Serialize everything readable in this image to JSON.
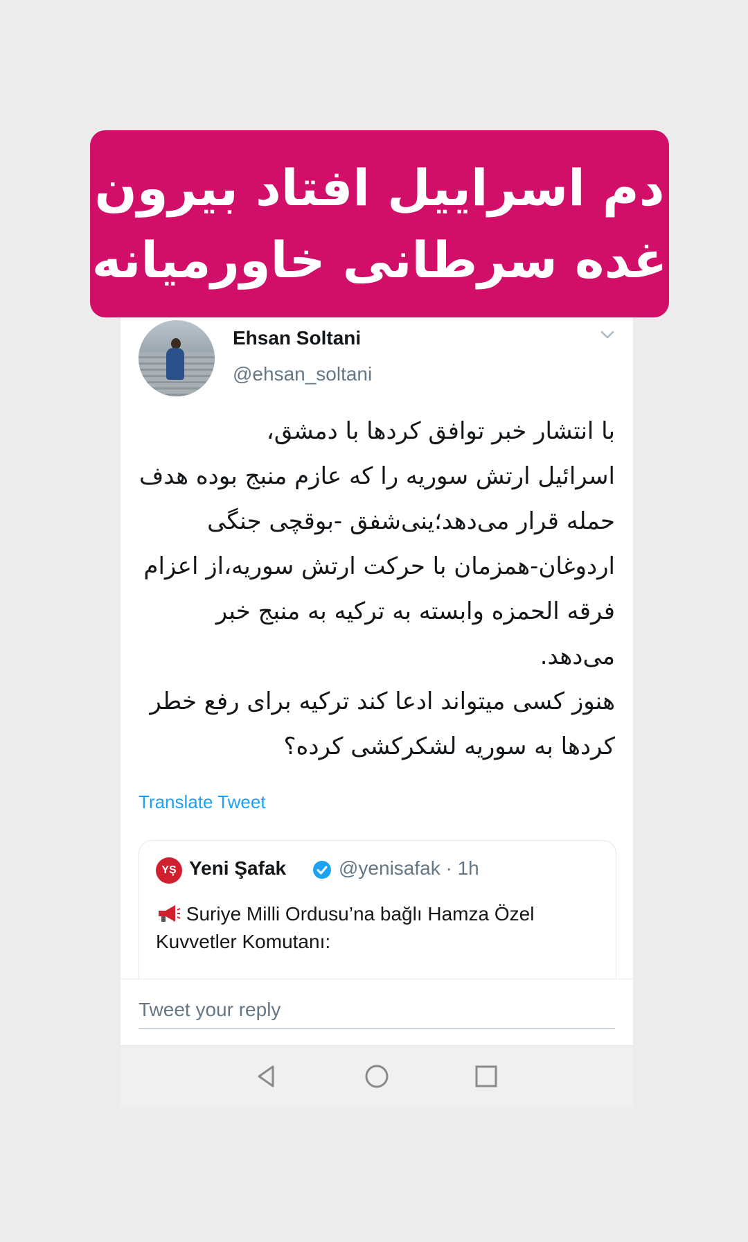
{
  "banner": {
    "line1": "دم اسراییل افتاد بیرون",
    "line2": "غده سرطانی خاورمیانه",
    "color": "#d10f68"
  },
  "tweet": {
    "author_name": "Ehsan Soltani",
    "author_handle": "@ehsan_soltani",
    "avatar_icon": "profile-photo",
    "menu_icon": "chevron-down-icon",
    "text": "با انتشار خبر توافق کردها با دمشق،\nاسرائیل ارتش سوریه را که عازم منبج بوده هدف حمله قرار می‌دهد؛ینی‌شفق -بوقچی جنگی اردوغان-همزمان با حرکت ارتش سوریه،از اعزام فرقه الحمزه وابسته به ترکیه به منبج خبر می‌دهد.\nهنوز کسی میتواند ادعا کند ترکیه برای رفع خطر کردها به سوریه لشکرکشی کرده؟",
    "translate_label": "Translate Tweet",
    "accent_color": "#1da1f2"
  },
  "quoted_tweet": {
    "logo_text": "YŞ",
    "name": "Yeni Şafak",
    "verified_icon": "verified-badge-icon",
    "handle_time": "@yenisafak · 1h",
    "emoji_icon": "megaphone-icon",
    "text": "Suriye Milli Ordusu’na bağlı Hamza Özel Kuvvetler Komutanı:"
  },
  "reply": {
    "placeholder": "Tweet your reply"
  },
  "navbar": {
    "back_icon": "back-triangle-icon",
    "home_icon": "home-circle-icon",
    "recents_icon": "recents-square-icon"
  }
}
